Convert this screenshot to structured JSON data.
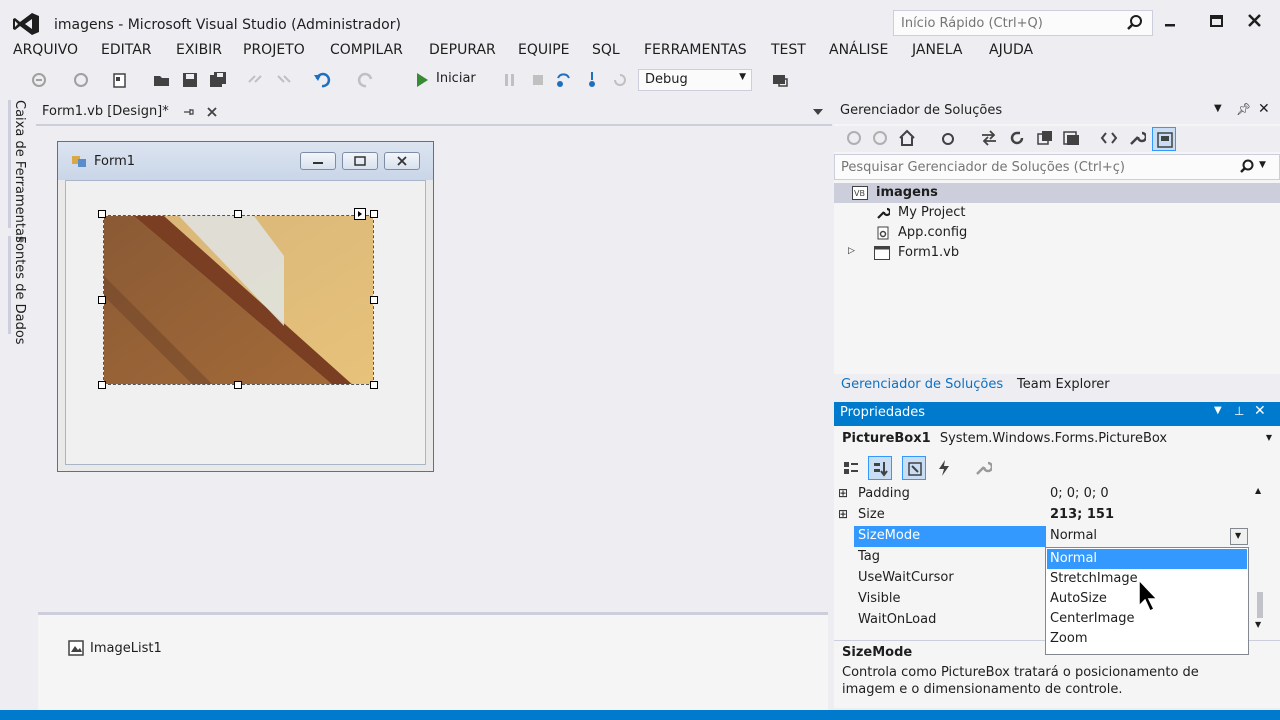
{
  "window": {
    "title": "imagens - Microsoft Visual Studio (Administrador)",
    "quick_launch_placeholder": "Início Rápido (Ctrl+Q)"
  },
  "menu": [
    "ARQUIVO",
    "EDITAR",
    "EXIBIR",
    "PROJETO",
    "COMPILAR",
    "DEPURAR",
    "EQUIPE",
    "SQL",
    "FERRAMENTAS",
    "TEST",
    "ANÁLISE",
    "JANELA",
    "AJUDA"
  ],
  "toolbar": {
    "run_label": "Iniciar",
    "configuration": "Debug"
  },
  "left_tabs": [
    "Caixa de Ferramentas",
    "Fontes de Dados"
  ],
  "document_tab": {
    "label": "Form1.vb [Design]*"
  },
  "designer": {
    "form_title": "Form1",
    "component_tray": [
      "ImageList1"
    ]
  },
  "solution_explorer": {
    "title": "Gerenciador de Soluções",
    "search_placeholder": "Pesquisar Gerenciador de Soluções (Ctrl+ç)",
    "tree": [
      {
        "label": "imagens",
        "icon": "vb-project-icon",
        "selected": true
      },
      {
        "label": "My Project",
        "icon": "wrench-icon"
      },
      {
        "label": "App.config",
        "icon": "config-file-icon"
      },
      {
        "label": "Form1.vb",
        "icon": "form-icon",
        "expandable": true
      }
    ],
    "bottom_tabs": [
      "Gerenciador de Soluções",
      "Team Explorer"
    ]
  },
  "properties": {
    "title": "Propriedades",
    "object_name": "PictureBox1",
    "object_type": "System.Windows.Forms.PictureBox",
    "rows": [
      {
        "name": "Padding",
        "value": "0; 0; 0; 0",
        "expandable": true
      },
      {
        "name": "Size",
        "value": "213; 151",
        "expandable": true,
        "bold": true
      },
      {
        "name": "SizeMode",
        "value": "Normal",
        "selected": true
      },
      {
        "name": "Tag",
        "value": ""
      },
      {
        "name": "UseWaitCursor",
        "value": ""
      },
      {
        "name": "Visible",
        "value": ""
      },
      {
        "name": "WaitOnLoad",
        "value": ""
      }
    ],
    "dropdown_options": [
      "Normal",
      "StretchImage",
      "AutoSize",
      "CenterImage",
      "Zoom"
    ],
    "dropdown_selected": "Normal",
    "description_title": "SizeMode",
    "description_text": "Controla como PictureBox tratará o posicionamento de imagem e o dimensionamento de controle."
  },
  "colors": {
    "accent": "#007ACC",
    "selection": "#3399FF",
    "chrome": "#EEEEF2"
  }
}
